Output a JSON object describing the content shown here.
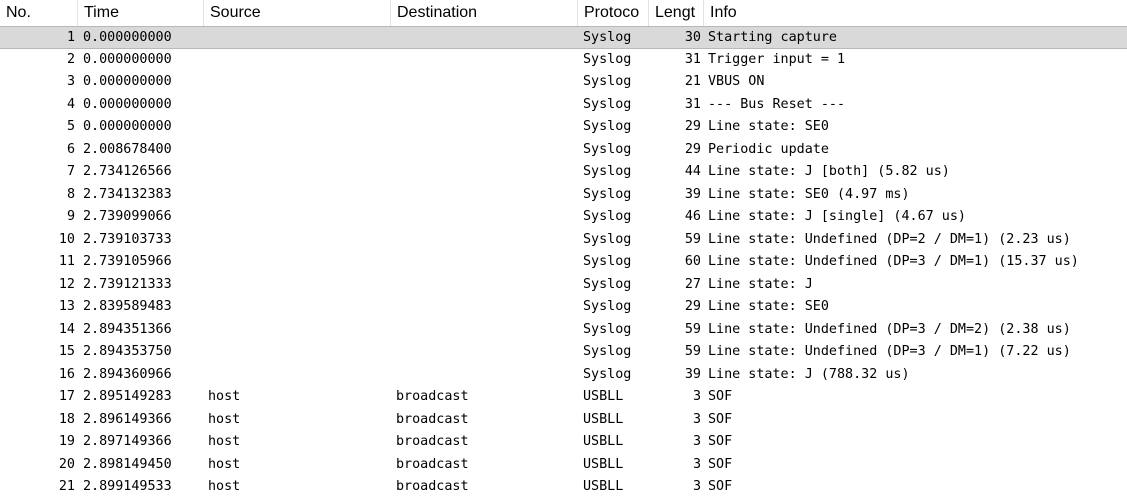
{
  "columns": {
    "no": "No.",
    "time": "Time",
    "source": "Source",
    "destination": "Destination",
    "protocol": "Protoco",
    "length": "Lengt",
    "info": "Info"
  },
  "selected_row": 0,
  "rows": [
    {
      "no": "1",
      "time": "0.000000000",
      "source": "",
      "destination": "",
      "protocol": "Syslog",
      "length": "30",
      "info": "Starting capture"
    },
    {
      "no": "2",
      "time": "0.000000000",
      "source": "",
      "destination": "",
      "protocol": "Syslog",
      "length": "31",
      "info": "Trigger input = 1"
    },
    {
      "no": "3",
      "time": "0.000000000",
      "source": "",
      "destination": "",
      "protocol": "Syslog",
      "length": "21",
      "info": "VBUS ON"
    },
    {
      "no": "4",
      "time": "0.000000000",
      "source": "",
      "destination": "",
      "protocol": "Syslog",
      "length": "31",
      "info": "--- Bus Reset ---"
    },
    {
      "no": "5",
      "time": "0.000000000",
      "source": "",
      "destination": "",
      "protocol": "Syslog",
      "length": "29",
      "info": "Line state: SE0"
    },
    {
      "no": "6",
      "time": "2.008678400",
      "source": "",
      "destination": "",
      "protocol": "Syslog",
      "length": "29",
      "info": "Periodic update"
    },
    {
      "no": "7",
      "time": "2.734126566",
      "source": "",
      "destination": "",
      "protocol": "Syslog",
      "length": "44",
      "info": "Line state: J [both] (5.82 us)"
    },
    {
      "no": "8",
      "time": "2.734132383",
      "source": "",
      "destination": "",
      "protocol": "Syslog",
      "length": "39",
      "info": "Line state: SE0 (4.97 ms)"
    },
    {
      "no": "9",
      "time": "2.739099066",
      "source": "",
      "destination": "",
      "protocol": "Syslog",
      "length": "46",
      "info": "Line state: J [single] (4.67 us)"
    },
    {
      "no": "10",
      "time": "2.739103733",
      "source": "",
      "destination": "",
      "protocol": "Syslog",
      "length": "59",
      "info": "Line state: Undefined (DP=2 / DM=1) (2.23 us)"
    },
    {
      "no": "11",
      "time": "2.739105966",
      "source": "",
      "destination": "",
      "protocol": "Syslog",
      "length": "60",
      "info": "Line state: Undefined (DP=3 / DM=1) (15.37 us)"
    },
    {
      "no": "12",
      "time": "2.739121333",
      "source": "",
      "destination": "",
      "protocol": "Syslog",
      "length": "27",
      "info": "Line state: J"
    },
    {
      "no": "13",
      "time": "2.839589483",
      "source": "",
      "destination": "",
      "protocol": "Syslog",
      "length": "29",
      "info": "Line state: SE0"
    },
    {
      "no": "14",
      "time": "2.894351366",
      "source": "",
      "destination": "",
      "protocol": "Syslog",
      "length": "59",
      "info": "Line state: Undefined (DP=3 / DM=2) (2.38 us)"
    },
    {
      "no": "15",
      "time": "2.894353750",
      "source": "",
      "destination": "",
      "protocol": "Syslog",
      "length": "59",
      "info": "Line state: Undefined (DP=3 / DM=1) (7.22 us)"
    },
    {
      "no": "16",
      "time": "2.894360966",
      "source": "",
      "destination": "",
      "protocol": "Syslog",
      "length": "39",
      "info": "Line state: J (788.32 us)"
    },
    {
      "no": "17",
      "time": "2.895149283",
      "source": "host",
      "destination": "broadcast",
      "protocol": "USBLL",
      "length": "3",
      "info": "SOF"
    },
    {
      "no": "18",
      "time": "2.896149366",
      "source": "host",
      "destination": "broadcast",
      "protocol": "USBLL",
      "length": "3",
      "info": "SOF"
    },
    {
      "no": "19",
      "time": "2.897149366",
      "source": "host",
      "destination": "broadcast",
      "protocol": "USBLL",
      "length": "3",
      "info": "SOF"
    },
    {
      "no": "20",
      "time": "2.898149450",
      "source": "host",
      "destination": "broadcast",
      "protocol": "USBLL",
      "length": "3",
      "info": "SOF"
    },
    {
      "no": "21",
      "time": "2.899149533",
      "source": "host",
      "destination": "broadcast",
      "protocol": "USBLL",
      "length": "3",
      "info": "SOF"
    }
  ]
}
